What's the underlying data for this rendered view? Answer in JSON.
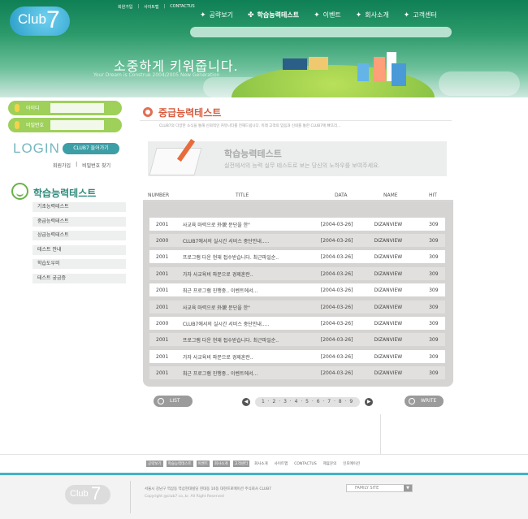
{
  "brand": {
    "logo_text": "Club",
    "logo_num": "7"
  },
  "util_links": [
    "회원가입",
    "사이트맵",
    "CONTACTUS"
  ],
  "gnb": [
    {
      "label": "공략보기"
    },
    {
      "label": "학습능력테스트"
    },
    {
      "label": "이벤트"
    },
    {
      "label": "회사소개"
    },
    {
      "label": "고객센터"
    }
  ],
  "hero": {
    "slogan": "소중하게 키워줍니다.",
    "sub": "Your Dream is Construe 2004/2005 New Generation"
  },
  "login": {
    "id_label": "아이디",
    "pw_label": "비밀번호",
    "login_word": "LOGIN",
    "login_button": "CLUB7 들어가기",
    "join_link": "회원가입",
    "find_link": "비밀번호 찾기"
  },
  "side": {
    "title": "학습능력테스트",
    "menu": [
      "기초능력테스트",
      "중급능력테스트",
      "상급능력테스트",
      "테스트 안내",
      "학습도우미",
      "테스트 궁금증"
    ]
  },
  "page": {
    "title": "중급능력테스트",
    "desc": "CLUB7의 다양한 소식을 통해 신뢰적인 커뮤니티를 전해드립니다. 미래 고객의 믿음과 신뢰를 통한 CLUB7에 빠뜨리...",
    "banner_title": "학습능력테스트",
    "banner_sub": "실전에서의 능력 실무 테스트로 보는 당신의 노하우를 보여주세요."
  },
  "table": {
    "headers": {
      "number": "NUMBER",
      "title": "TITLE",
      "data": "DATA",
      "name": "NAME",
      "hit": "HIT"
    },
    "rows": [
      {
        "num": "2001",
        "title": "사교육 마력으로 外貌 문단을 한\"",
        "date": "[2004-03-26]",
        "name": "DIZANVIEW",
        "hit": "309"
      },
      {
        "num": "2000",
        "title": "CLUB7에서의 실시간 서비스 중단안내.....",
        "date": "[2004-03-26]",
        "name": "DIZANVIEW",
        "hit": "309"
      },
      {
        "num": "2001",
        "title": "프로그램 다운 현재 접수받습니다. 최근파일순..",
        "date": "[2004-03-26]",
        "name": "DIZANVIEW",
        "hit": "309"
      },
      {
        "num": "2001",
        "title": "가자 사교육비 파문으로 경제혼란..",
        "date": "[2004-03-26]",
        "name": "DIZANVIEW",
        "hit": "309"
      },
      {
        "num": "2001",
        "title": "최근 프로그램 진행중.. 이벤트에서...",
        "date": "[2004-03-26]",
        "name": "DIZANVIEW",
        "hit": "309"
      },
      {
        "num": "2001",
        "title": "사교육 마력으로 外貌 문단을 한\"",
        "date": "[2004-03-26]",
        "name": "DIZANVIEW",
        "hit": "309"
      },
      {
        "num": "2000",
        "title": "CLUB7에서의 실시간 서비스 중단안내.....",
        "date": "[2004-03-26]",
        "name": "DIZANVIEW",
        "hit": "309"
      },
      {
        "num": "2001",
        "title": "프로그램 다운 현재 접수받습니다. 최근파일순..",
        "date": "[2004-03-26]",
        "name": "DIZANVIEW",
        "hit": "309"
      },
      {
        "num": "2001",
        "title": "가자 사교육비 파문으로 경제혼란..",
        "date": "[2004-03-26]",
        "name": "DIZANVIEW",
        "hit": "309"
      },
      {
        "num": "2001",
        "title": "최근 프로그램 진행중.. 이벤트에서...",
        "date": "[2004-03-26]",
        "name": "DIZANVIEW",
        "hit": "309"
      }
    ]
  },
  "buttons": {
    "list": "LIST",
    "write": "WRITE"
  },
  "pager": {
    "pages": "1 · 2 · 3 · 4 · 5 · 6 · 7 · 8 · 9"
  },
  "footer": {
    "nav": [
      "공략보기",
      "학습능력테스트",
      "이벤트",
      "회사소개",
      "고객센터",
      "회사소개",
      "사이트맵",
      "CONTACTUS",
      "제휴문의",
      "인포메이션"
    ],
    "address": "서울시 강남구 역삼동 역삼현대빌딩 현대동 10동 대현프로메이션 주식회사 CLUB7",
    "copyright": "Copyright @club7 co.,kr. All Right Reserved",
    "family_site": "FAMILY SITE"
  },
  "colors": {
    "header_green": "#0f7f55",
    "accent_orange": "#d75a3d",
    "teal": "#3d9ea6",
    "footer_bar": "#42b3c4"
  }
}
